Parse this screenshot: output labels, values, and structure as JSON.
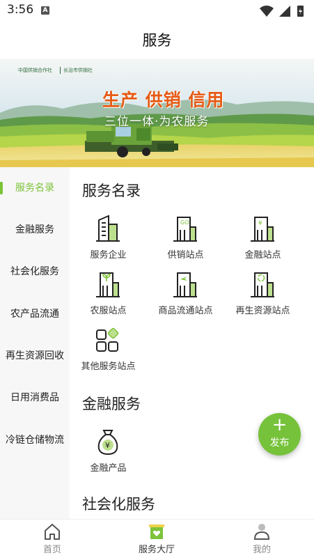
{
  "status": {
    "time": "3:56",
    "notification_letter": "A"
  },
  "header": {
    "title": "服务"
  },
  "banner": {
    "org_name": "中国供销合作社",
    "org_local": "长治市供销社",
    "slogan": "生产 供销 信用",
    "subtitle": "三位一体·为农服务"
  },
  "sidebar": {
    "items": [
      {
        "label": "服务名录",
        "active": true
      },
      {
        "label": "金融服务",
        "active": false
      },
      {
        "label": "社会化服务",
        "active": false
      },
      {
        "label": "农产品流通",
        "active": false
      },
      {
        "label": "再生资源回收",
        "active": false
      },
      {
        "label": "日用消费品",
        "active": false
      },
      {
        "label": "冷链仓储物流",
        "active": false
      }
    ]
  },
  "sections": {
    "directory": {
      "title": "服务名录",
      "items": [
        {
          "label": "服务企业",
          "icon": "enterprise-building-icon"
        },
        {
          "label": "供销站点",
          "icon": "supply-station-icon"
        },
        {
          "label": "金融站点",
          "icon": "finance-station-icon"
        },
        {
          "label": "农服站点",
          "icon": "agri-service-station-icon"
        },
        {
          "label": "商品流通站点",
          "icon": "logistics-station-icon"
        },
        {
          "label": "再生资源站点",
          "icon": "recycle-station-icon"
        },
        {
          "label": "其他服务站点",
          "icon": "other-services-grid-icon"
        }
      ]
    },
    "finance": {
      "title": "金融服务",
      "items": [
        {
          "label": "金融产品",
          "icon": "money-bag-icon"
        }
      ]
    },
    "social": {
      "title": "社会化服务"
    }
  },
  "fab": {
    "label": "发布",
    "icon": "plus-icon"
  },
  "tabbar": {
    "tabs": [
      {
        "label": "首页",
        "icon": "home-icon",
        "active": false
      },
      {
        "label": "服务大厅",
        "icon": "service-hall-icon",
        "active": true
      },
      {
        "label": "我的",
        "icon": "profile-icon",
        "active": false
      }
    ]
  },
  "colors": {
    "accent": "#7dc33a",
    "fab": "#76c23a",
    "slogan": "#e65a14"
  }
}
